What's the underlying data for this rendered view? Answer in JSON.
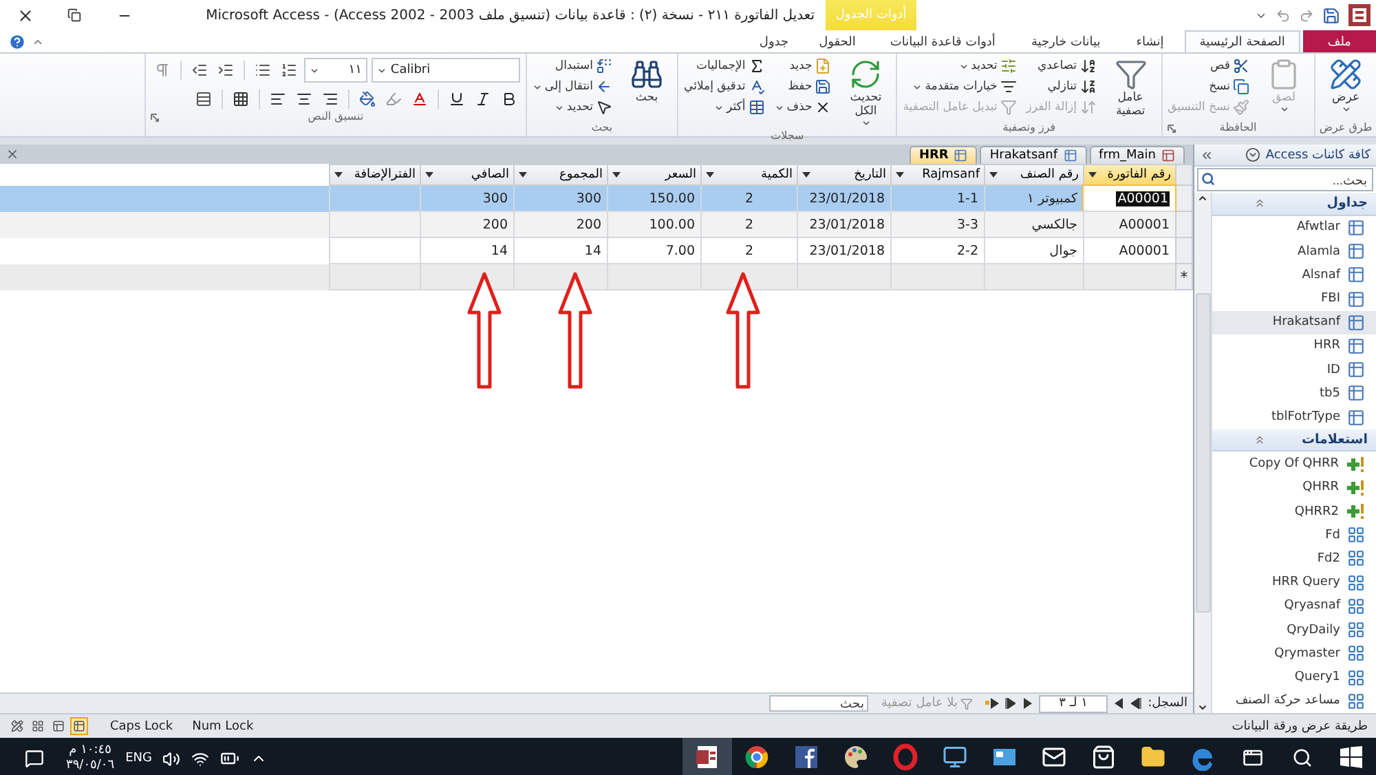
{
  "window": {
    "title": "تعديل الفاتورة ٢١١ - نسخة (٢) : قاعدة بيانات (تنسيق ملف 2003 - Access 2002) - Microsoft Access",
    "context_tab_group": "أدوات الجدول"
  },
  "ribbon_tabs": [
    {
      "label": "ملف",
      "kind": "file",
      "selected": false
    },
    {
      "label": "الصفحة الرئيسية",
      "kind": "tab",
      "selected": true
    },
    {
      "label": "إنشاء",
      "kind": "tab",
      "selected": false
    },
    {
      "label": "بيانات خارجية",
      "kind": "tab",
      "selected": false
    },
    {
      "label": "أدوات قاعدة البيانات",
      "kind": "tab",
      "selected": false
    },
    {
      "label": "الحقول",
      "kind": "context",
      "selected": false
    },
    {
      "label": "جدول",
      "kind": "context",
      "selected": false
    }
  ],
  "ribbon_groups": [
    {
      "label": "طرق عرض",
      "kind": "commands",
      "launcher": false,
      "items": [
        {
          "kind": "large",
          "label": "عرض",
          "dropdown": true,
          "disabled": false
        }
      ]
    },
    {
      "label": "الحافظة",
      "kind": "commands",
      "launcher": true,
      "items": [
        {
          "kind": "large",
          "label": "لصق",
          "dropdown": true,
          "disabled": true
        },
        {
          "kind": "small",
          "label": "قص",
          "dropdown": false,
          "disabled": false
        },
        {
          "kind": "small",
          "label": "نسخ",
          "dropdown": false,
          "disabled": false
        },
        {
          "kind": "small",
          "label": "نسخ التنسيق",
          "dropdown": false,
          "disabled": true
        }
      ]
    },
    {
      "label": "فرز وتصفية",
      "kind": "commands",
      "launcher": false,
      "items": [
        {
          "kind": "large",
          "label": "عامل تصفية",
          "dropdown": false,
          "disabled": false
        },
        {
          "kind": "small",
          "label": "تصاعدي",
          "dropdown": false,
          "disabled": false
        },
        {
          "kind": "small",
          "label": "تنازلي",
          "dropdown": false,
          "disabled": false
        },
        {
          "kind": "small",
          "label": "إزالة الفرز",
          "dropdown": false,
          "disabled": true
        },
        {
          "kind": "small",
          "label": "تحديد",
          "dropdown": true,
          "disabled": false
        },
        {
          "kind": "small",
          "label": "خيارات متقدمة",
          "dropdown": true,
          "disabled": false
        },
        {
          "kind": "small",
          "label": "تبديل عامل التصفية",
          "dropdown": false,
          "disabled": true
        }
      ]
    },
    {
      "label": "سجلات",
      "kind": "commands",
      "launcher": false,
      "items": [
        {
          "kind": "large",
          "label": "تحديث الكل",
          "dropdown": true,
          "disabled": false
        },
        {
          "kind": "small",
          "label": "جديد",
          "dropdown": false,
          "disabled": false
        },
        {
          "kind": "small",
          "label": "حفظ",
          "dropdown": false,
          "disabled": false
        },
        {
          "kind": "small",
          "label": "حذف",
          "dropdown": true,
          "disabled": false
        },
        {
          "kind": "small",
          "label": "الإجماليات",
          "dropdown": false,
          "disabled": false
        },
        {
          "kind": "small",
          "label": "تدقيق إملائي",
          "dropdown": false,
          "disabled": false
        },
        {
          "kind": "small",
          "label": "أكثر",
          "dropdown": true,
          "disabled": false
        }
      ]
    },
    {
      "label": "بحث",
      "kind": "commands",
      "launcher": false,
      "items": [
        {
          "kind": "large",
          "label": "بحث",
          "dropdown": false,
          "disabled": false
        },
        {
          "kind": "small",
          "label": "استبدال",
          "dropdown": false,
          "disabled": false
        },
        {
          "kind": "small",
          "label": "انتقال إلى",
          "dropdown": true,
          "disabled": false
        },
        {
          "kind": "small",
          "label": "تحديد",
          "dropdown": true,
          "disabled": false
        }
      ]
    },
    {
      "label": "تنسيق النص",
      "kind": "text_format",
      "launcher": true,
      "items": [
        {
          "kind": "font",
          "value": "Calibri"
        },
        {
          "kind": "size",
          "value": "١١"
        }
      ]
    }
  ],
  "document_tabs": [
    {
      "label": "frm_Main",
      "kind": "form",
      "selected": false
    },
    {
      "label": "Hrakatsanf",
      "kind": "table",
      "selected": false
    },
    {
      "label": "HRR",
      "kind": "table",
      "selected": true
    }
  ],
  "datasheet": {
    "columns": [
      {
        "label": "رقم الفاتورة",
        "current": true
      },
      {
        "label": "رقم الصنف",
        "current": false
      },
      {
        "label": "Rajmsanf",
        "current": false
      },
      {
        "label": "التاريخ",
        "current": false
      },
      {
        "label": "الكمية",
        "current": false
      },
      {
        "label": "السعر",
        "current": false
      },
      {
        "label": "المجموع",
        "current": false
      },
      {
        "label": "الصافي",
        "current": false
      },
      {
        "label": "الفترالإضافة",
        "current": false
      }
    ],
    "rows": [
      {
        "selected": true,
        "cells": [
          "A00001",
          "كمبيوتر ١",
          "1-1",
          "23/01/2018",
          "2",
          "150.00",
          "300",
          "300",
          ""
        ]
      },
      {
        "selected": false,
        "cells": [
          "A00001",
          "جالكسي",
          "3-3",
          "23/01/2018",
          "2",
          "100.00",
          "200",
          "200",
          ""
        ]
      },
      {
        "selected": false,
        "cells": [
          "A00001",
          "جوال",
          "2-2",
          "23/01/2018",
          "2",
          "7.00",
          "14",
          "14",
          ""
        ]
      }
    ],
    "new_row_marker": "*"
  },
  "annotations": [
    {
      "kind": "arrow"
    },
    {
      "kind": "arrow"
    },
    {
      "kind": "arrow"
    }
  ],
  "record_navigator": {
    "label": "السجل:",
    "position": "١ لـ ٣",
    "filter": "بلا عامل تصفية",
    "search_placeholder": "بحث"
  },
  "navigation_pane": {
    "title": "كافة كائنات Access",
    "search_placeholder": "بحث...",
    "groups": [
      {
        "label": "جداول",
        "expanded": true,
        "items": [
          {
            "label": "Afwtlar",
            "kind": "table",
            "selected": false
          },
          {
            "label": "Alamla",
            "kind": "table",
            "selected": false
          },
          {
            "label": "Alsnaf",
            "kind": "table",
            "selected": false
          },
          {
            "label": "FBI",
            "kind": "table",
            "selected": false
          },
          {
            "label": "Hrakatsanf",
            "kind": "table",
            "selected": true
          },
          {
            "label": "HRR",
            "kind": "table",
            "selected": false
          },
          {
            "label": "ID",
            "kind": "table",
            "selected": false
          },
          {
            "label": "tb5",
            "kind": "table",
            "selected": false
          },
          {
            "label": "tblFotrType",
            "kind": "table",
            "selected": false
          }
        ]
      },
      {
        "label": "استعلامات",
        "expanded": true,
        "items": [
          {
            "label": "Copy Of QHRR",
            "kind": "action_query",
            "selected": false
          },
          {
            "label": "QHRR",
            "kind": "action_query",
            "selected": false
          },
          {
            "label": "QHRR2",
            "kind": "action_query",
            "selected": false
          },
          {
            "label": "Fd",
            "kind": "query",
            "selected": false
          },
          {
            "label": "Fd2",
            "kind": "query",
            "selected": false
          },
          {
            "label": "HRR Query",
            "kind": "query",
            "selected": false
          },
          {
            "label": "Qryasnaf",
            "kind": "query",
            "selected": false
          },
          {
            "label": "QryDaily",
            "kind": "query",
            "selected": false
          },
          {
            "label": "Qrymaster",
            "kind": "query",
            "selected": false
          },
          {
            "label": "Query1",
            "kind": "query",
            "selected": false
          },
          {
            "label": "مساعد حركة الصنف",
            "kind": "query",
            "selected": false
          }
        ]
      }
    ]
  },
  "status_bar": {
    "text": "طريقة عرض ورقة البيانات",
    "indicators": [
      "Num Lock",
      "Caps Lock"
    ],
    "views": [
      {
        "selected": true
      },
      {
        "selected": false
      },
      {
        "selected": false
      },
      {
        "selected": false
      }
    ]
  },
  "taskbar": {
    "language": "ENG",
    "time": "١٠:٤٥ م",
    "date": "٣٩/٠٥/٠٦",
    "apps": [
      {
        "kind": "edge",
        "active": false
      },
      {
        "kind": "folder",
        "active": false
      },
      {
        "kind": "store",
        "active": false
      },
      {
        "kind": "mail",
        "active": false
      },
      {
        "kind": "window",
        "active": false
      },
      {
        "kind": "computer",
        "active": false
      },
      {
        "kind": "opera",
        "active": false
      },
      {
        "kind": "paint",
        "active": false
      },
      {
        "kind": "facebook",
        "active": false
      },
      {
        "kind": "chrome",
        "active": false
      },
      {
        "kind": "access",
        "active": true
      }
    ]
  }
}
